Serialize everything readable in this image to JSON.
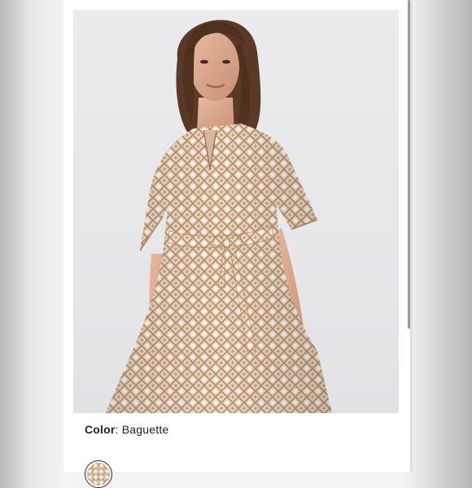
{
  "product": {
    "color_label": "Color",
    "color_separator": ": ",
    "color_value": "Baguette",
    "image_icon": "product-photo",
    "swatch_icon": "color-swatch"
  },
  "colors": {
    "pattern_base": "#dcc3a6",
    "pattern_line": "#b08a66",
    "background": "#e8e8eb"
  }
}
